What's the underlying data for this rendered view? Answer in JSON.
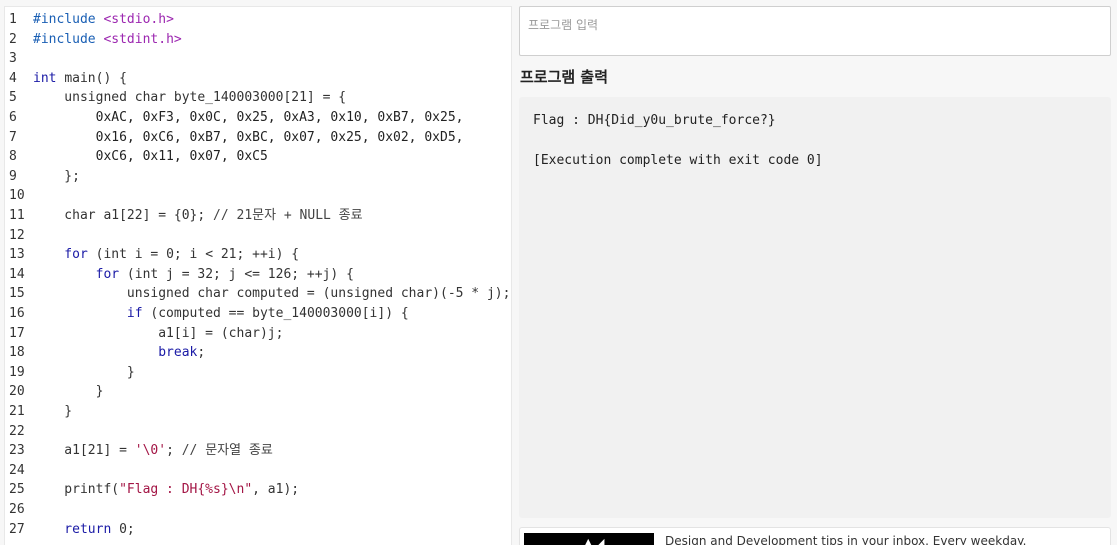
{
  "editor": {
    "lines": [
      {
        "n": "1",
        "segs": [
          [
            "pp",
            "#include "
          ],
          [
            "hdr",
            "<stdio.h>"
          ]
        ]
      },
      {
        "n": "2",
        "segs": [
          [
            "pp",
            "#include "
          ],
          [
            "hdr",
            "<stdint.h>"
          ]
        ]
      },
      {
        "n": "3",
        "segs": []
      },
      {
        "n": "4",
        "segs": [
          [
            "kw",
            "int "
          ],
          [
            "plain",
            "main() {"
          ]
        ]
      },
      {
        "n": "5",
        "segs": [
          [
            "plain",
            "    unsigned char byte_140003000[21] = {"
          ]
        ]
      },
      {
        "n": "6",
        "segs": [
          [
            "num",
            "        0xAC, 0xF3, 0x0C, 0x25, 0xA3, 0x10, 0xB7, 0x25,"
          ]
        ]
      },
      {
        "n": "7",
        "segs": [
          [
            "num",
            "        0x16, 0xC6, 0xB7, 0xBC, 0x07, 0x25, 0x02, 0xD5,"
          ]
        ]
      },
      {
        "n": "8",
        "segs": [
          [
            "num",
            "        0xC6, 0x11, 0x07, 0xC5"
          ]
        ]
      },
      {
        "n": "9",
        "segs": [
          [
            "plain",
            "    };"
          ]
        ]
      },
      {
        "n": "10",
        "segs": []
      },
      {
        "n": "11",
        "segs": [
          [
            "plain",
            "    char a1[22] = {0}; "
          ],
          [
            "cm",
            "// 21문자 + NULL 종료"
          ]
        ]
      },
      {
        "n": "12",
        "segs": []
      },
      {
        "n": "13",
        "segs": [
          [
            "kw",
            "    for "
          ],
          [
            "plain",
            "(int i = 0; i < 21; ++i) {"
          ]
        ]
      },
      {
        "n": "14",
        "segs": [
          [
            "kw",
            "        for "
          ],
          [
            "plain",
            "(int j = 32; j <= 126; ++j) {"
          ]
        ]
      },
      {
        "n": "15",
        "segs": [
          [
            "plain",
            "            unsigned char computed = (unsigned char)(-5 * j);"
          ]
        ]
      },
      {
        "n": "16",
        "segs": [
          [
            "kw",
            "            if "
          ],
          [
            "plain",
            "(computed == byte_140003000[i]) {"
          ]
        ]
      },
      {
        "n": "17",
        "segs": [
          [
            "plain",
            "                a1[i] = (char)j;"
          ]
        ]
      },
      {
        "n": "18",
        "segs": [
          [
            "kw",
            "                break"
          ],
          [
            "plain",
            ";"
          ]
        ]
      },
      {
        "n": "19",
        "segs": [
          [
            "plain",
            "            }"
          ]
        ]
      },
      {
        "n": "20",
        "segs": [
          [
            "plain",
            "        }"
          ]
        ]
      },
      {
        "n": "21",
        "segs": [
          [
            "plain",
            "    }"
          ]
        ]
      },
      {
        "n": "22",
        "segs": []
      },
      {
        "n": "23",
        "segs": [
          [
            "plain",
            "    a1[21] = "
          ],
          [
            "str",
            "'\\0'"
          ],
          [
            "plain",
            "; "
          ],
          [
            "cm",
            "// 문자열 종료"
          ]
        ]
      },
      {
        "n": "24",
        "segs": []
      },
      {
        "n": "25",
        "segs": [
          [
            "plain",
            "    printf("
          ],
          [
            "str",
            "\"Flag : DH{%s}\\n\""
          ],
          [
            "plain",
            ", a1);"
          ]
        ]
      },
      {
        "n": "26",
        "segs": []
      },
      {
        "n": "27",
        "segs": [
          [
            "kw",
            "    return "
          ],
          [
            "plain",
            "0;"
          ]
        ]
      }
    ]
  },
  "input": {
    "placeholder": "프로그램 입력"
  },
  "output": {
    "title": "프로그램 출력",
    "text": "Flag : DH{Did_y0u_brute_force?}\n\n[Execution complete with exit code 0]"
  },
  "ad": {
    "text": "Design and Development tips in your inbox. Every weekday."
  },
  "colors": {
    "background": "#f7f7f7",
    "output_bg": "#f1f1f1",
    "keyword": "#1a1aa6",
    "string": "#a31545"
  }
}
